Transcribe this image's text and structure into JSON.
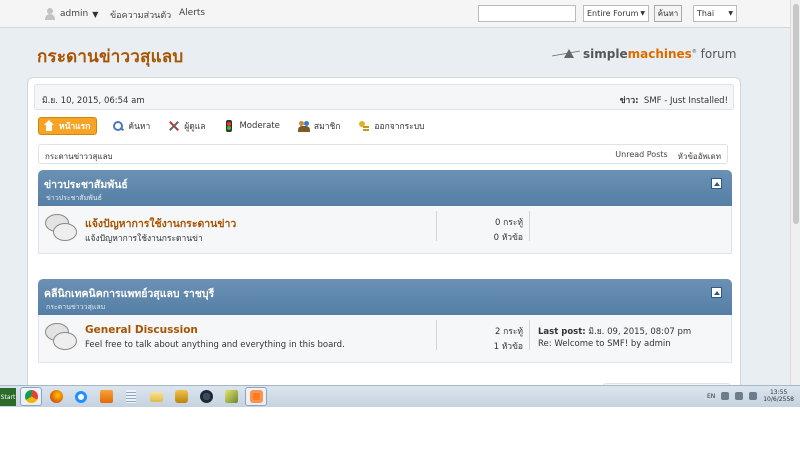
{
  "topbar": {
    "username": "admin",
    "links": [
      "ข้อความส่วนตัว",
      "Alerts"
    ],
    "search": {
      "value": "",
      "placeholder": ""
    },
    "scope_selected": "Entire Forum",
    "search_button": "ค้นหา",
    "language_selected": "Thai"
  },
  "header": {
    "forum_title": "กระดานข่าววสุแลบ",
    "logo": {
      "part1": "simple",
      "part2": "machines",
      "part3": "forum"
    }
  },
  "info": {
    "date": "มิ.ย. 10, 2015, 06:54 am",
    "news_label": "ข่าว:",
    "news_text": "SMF - Just Installed!"
  },
  "menu": [
    {
      "label": "หน้าแรก",
      "icon": "home-icon",
      "active": true
    },
    {
      "label": "ค้นหา",
      "icon": "search-icon",
      "active": false
    },
    {
      "label": "ผู้ดูแล",
      "icon": "tools-icon",
      "active": false
    },
    {
      "label": "Moderate",
      "icon": "traffic-light-icon",
      "active": false
    },
    {
      "label": "สมาชิก",
      "icon": "members-icon",
      "active": false
    },
    {
      "label": "ออกจากระบบ",
      "icon": "key-icon",
      "active": false
    }
  ],
  "navigate": {
    "breadcrumb": "กระดานข่าววสุแลบ",
    "unread_posts": "Unread Posts",
    "updated_topics": "หัวข้ออัพเดท"
  },
  "categories": [
    {
      "title": "ข่าวประชาสัมพันธ์",
      "subtitle": "ข่าวประชาสัมพันธ์",
      "board": {
        "name": "แจ้งปัญหาการใช้งานกระดานข่าว",
        "description": "แจ้งปัญหาการใช้งานกระดานข่า",
        "posts": "0 กระทู้",
        "topics": "0 หัวข้อ",
        "last_post_label": "",
        "last_post_date": "",
        "last_post_subject": ""
      }
    },
    {
      "title": "คลีนิกเทคนิคการแพทย์วสุแลบ ราชบุรี",
      "subtitle": "กระดานข่าววสุแลบ",
      "board": {
        "name": "General Discussion",
        "description": "Feel free to talk about anything and everything in this board.",
        "posts": "2 กระทู้",
        "topics": "1 หัวข้อ",
        "last_post_label": "Last post:",
        "last_post_date": "มิ.ย. 09, 2015, 08:07 pm",
        "last_post_subject": "Re: Welcome to SMF! by admin"
      }
    }
  ],
  "taskbar": {
    "start_label": "Start",
    "apps": [
      "chrome-icon",
      "firefox-icon",
      "ie-icon",
      "media-player-icon",
      "notepad-icon",
      "folder-icon",
      "gimp-icon",
      "steam-icon",
      "sketch-icon",
      "xampp-icon"
    ],
    "language": "EN",
    "clock_time": "13:55",
    "clock_date": "10/6/2558"
  },
  "colors": {
    "accent_orange": "#f7a325",
    "title_brown": "#a85400",
    "category_blue": "#5f88ad"
  }
}
